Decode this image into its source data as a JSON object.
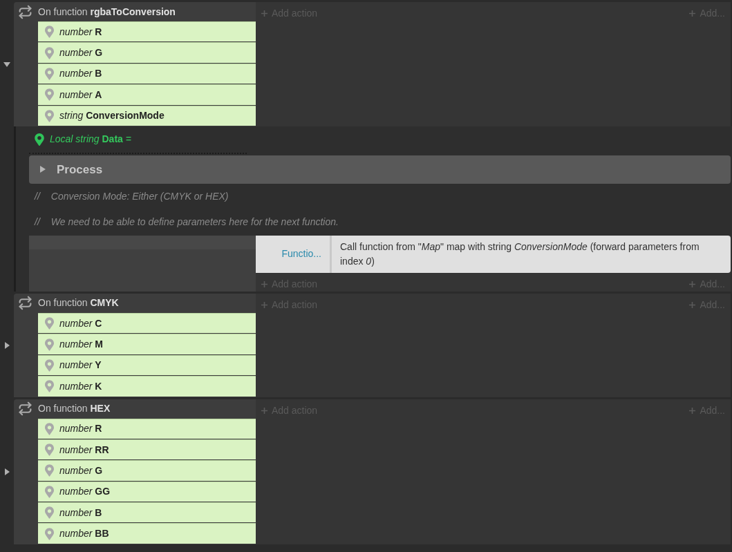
{
  "events": [
    {
      "kind": "function",
      "expanded": true,
      "label": "On function",
      "name": "rgbaToConversion",
      "params": [
        {
          "type": "number",
          "name": "R"
        },
        {
          "type": "number",
          "name": "G"
        },
        {
          "type": "number",
          "name": "B"
        },
        {
          "type": "number",
          "name": "A"
        },
        {
          "type": "string",
          "name": "ConversionMode"
        }
      ],
      "add_action": "Add action",
      "add_other": "Add...",
      "children": [
        {
          "kind": "local_variable",
          "label": "Local string",
          "name": "Data",
          "suffix": "="
        },
        {
          "kind": "group",
          "expanded": false,
          "title": "Process"
        },
        {
          "kind": "comment",
          "marker": "//",
          "text": "Conversion Mode: Either (CMYK or HEX)"
        },
        {
          "kind": "comment",
          "marker": "//",
          "text": "We need to be able to define parameters here for the next function."
        },
        {
          "kind": "event",
          "actions": [
            {
              "name": "Functio...",
              "text": "Call function from \"*Map*\" map with string *ConversionMode* (forward parameters from index *0*)"
            }
          ],
          "add_action": "Add action",
          "add_other": "Add..."
        }
      ]
    },
    {
      "kind": "function",
      "expanded": false,
      "label": "On function",
      "name": "CMYK",
      "params": [
        {
          "type": "number",
          "name": "C"
        },
        {
          "type": "number",
          "name": "M"
        },
        {
          "type": "number",
          "name": "Y"
        },
        {
          "type": "number",
          "name": "K"
        }
      ],
      "add_action": "Add action",
      "add_other": "Add..."
    },
    {
      "kind": "function",
      "expanded": false,
      "label": "On function",
      "name": "HEX",
      "params": [
        {
          "type": "number",
          "name": "R"
        },
        {
          "type": "number",
          "name": "RR"
        },
        {
          "type": "number",
          "name": "G"
        },
        {
          "type": "number",
          "name": "GG"
        },
        {
          "type": "number",
          "name": "B"
        },
        {
          "type": "number",
          "name": "BB"
        }
      ],
      "add_action": "Add action",
      "add_other": "Add..."
    }
  ]
}
